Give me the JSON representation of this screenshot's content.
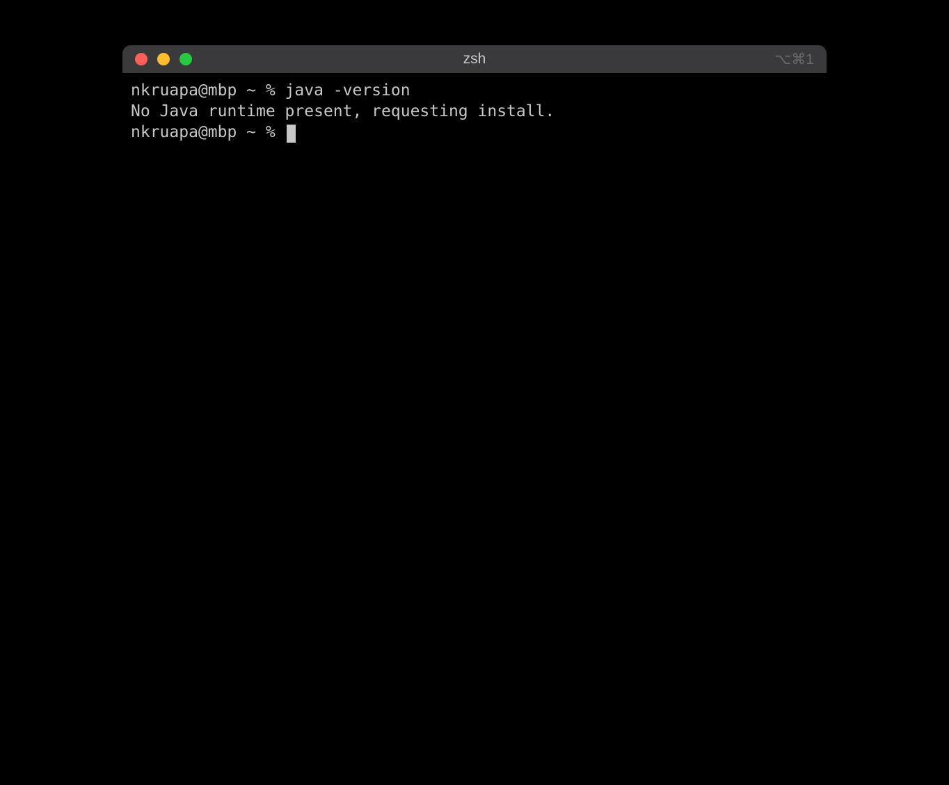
{
  "window": {
    "title": "zsh",
    "shortcut_hint": "⌥⌘1"
  },
  "terminal": {
    "lines": [
      {
        "prompt": "nkruapa@mbp ~ % ",
        "command": "java -version"
      },
      {
        "output": "No Java runtime present, requesting install."
      },
      {
        "prompt": "nkruapa@mbp ~ % ",
        "cursor": true
      }
    ]
  }
}
